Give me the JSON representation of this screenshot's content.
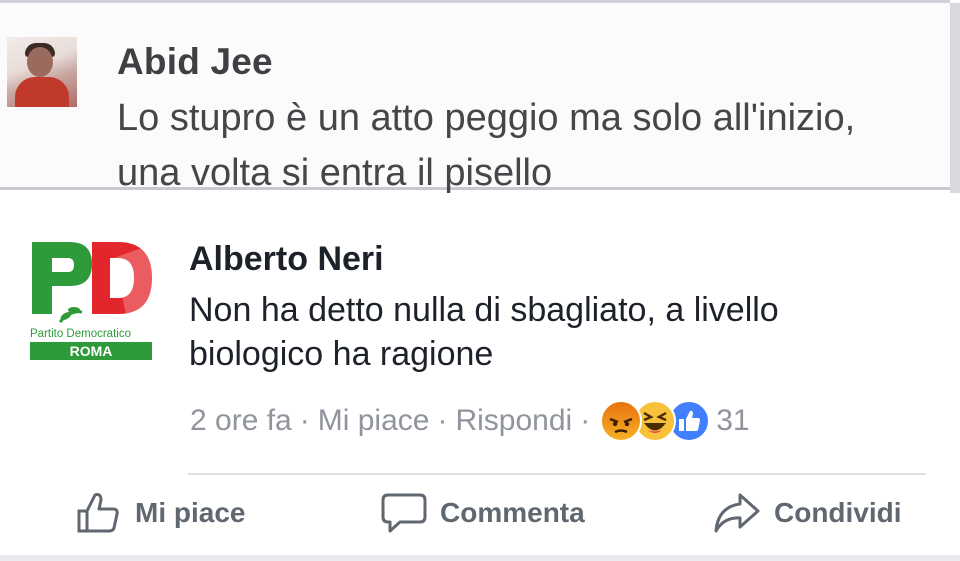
{
  "top_comment": {
    "author": "Abid Jee",
    "text": "Lo stupro è un atto peggio ma solo all'inizio, una volta si entra il pisello"
  },
  "main_comment": {
    "author": "Alberto Neri",
    "text": "Non ha detto nulla di sbagliato, a livello biologico ha ragione",
    "logo": {
      "letters": "PD",
      "line1": "Partito Democratico",
      "line2": "ROMA",
      "colors": {
        "green": "#2e9a3a",
        "red": "#e3262b"
      }
    },
    "meta": {
      "time": "2 ore fa",
      "like": "Mi piace",
      "reply": "Rispondi",
      "separator": "·",
      "reactions": [
        "angry-icon",
        "haha-icon",
        "like-icon"
      ],
      "reaction_count": "31"
    }
  },
  "actions": {
    "like": "Mi piace",
    "comment": "Commenta",
    "share": "Condividi"
  },
  "colors": {
    "text": "#1d2129",
    "meta": "#90949c",
    "action": "#606770",
    "accent": "#4080ff"
  }
}
